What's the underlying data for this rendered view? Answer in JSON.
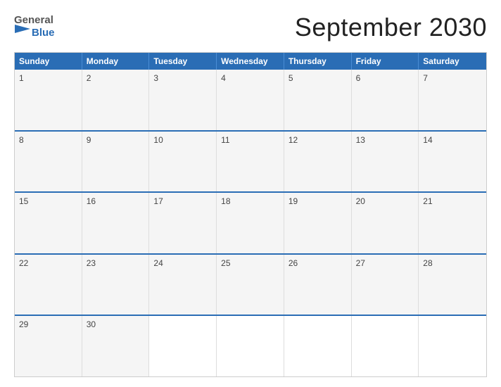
{
  "header": {
    "logo_general": "General",
    "logo_blue": "Blue",
    "title": "September 2030"
  },
  "calendar": {
    "day_headers": [
      "Sunday",
      "Monday",
      "Tuesday",
      "Wednesday",
      "Thursday",
      "Friday",
      "Saturday"
    ],
    "weeks": [
      [
        {
          "day": "1",
          "empty": false
        },
        {
          "day": "2",
          "empty": false
        },
        {
          "day": "3",
          "empty": false
        },
        {
          "day": "4",
          "empty": false
        },
        {
          "day": "5",
          "empty": false
        },
        {
          "day": "6",
          "empty": false
        },
        {
          "day": "7",
          "empty": false
        }
      ],
      [
        {
          "day": "8",
          "empty": false
        },
        {
          "day": "9",
          "empty": false
        },
        {
          "day": "10",
          "empty": false
        },
        {
          "day": "11",
          "empty": false
        },
        {
          "day": "12",
          "empty": false
        },
        {
          "day": "13",
          "empty": false
        },
        {
          "day": "14",
          "empty": false
        }
      ],
      [
        {
          "day": "15",
          "empty": false
        },
        {
          "day": "16",
          "empty": false
        },
        {
          "day": "17",
          "empty": false
        },
        {
          "day": "18",
          "empty": false
        },
        {
          "day": "19",
          "empty": false
        },
        {
          "day": "20",
          "empty": false
        },
        {
          "day": "21",
          "empty": false
        }
      ],
      [
        {
          "day": "22",
          "empty": false
        },
        {
          "day": "23",
          "empty": false
        },
        {
          "day": "24",
          "empty": false
        },
        {
          "day": "25",
          "empty": false
        },
        {
          "day": "26",
          "empty": false
        },
        {
          "day": "27",
          "empty": false
        },
        {
          "day": "28",
          "empty": false
        }
      ],
      [
        {
          "day": "29",
          "empty": false
        },
        {
          "day": "30",
          "empty": false
        },
        {
          "day": "",
          "empty": true
        },
        {
          "day": "",
          "empty": true
        },
        {
          "day": "",
          "empty": true
        },
        {
          "day": "",
          "empty": true
        },
        {
          "day": "",
          "empty": true
        }
      ]
    ]
  }
}
